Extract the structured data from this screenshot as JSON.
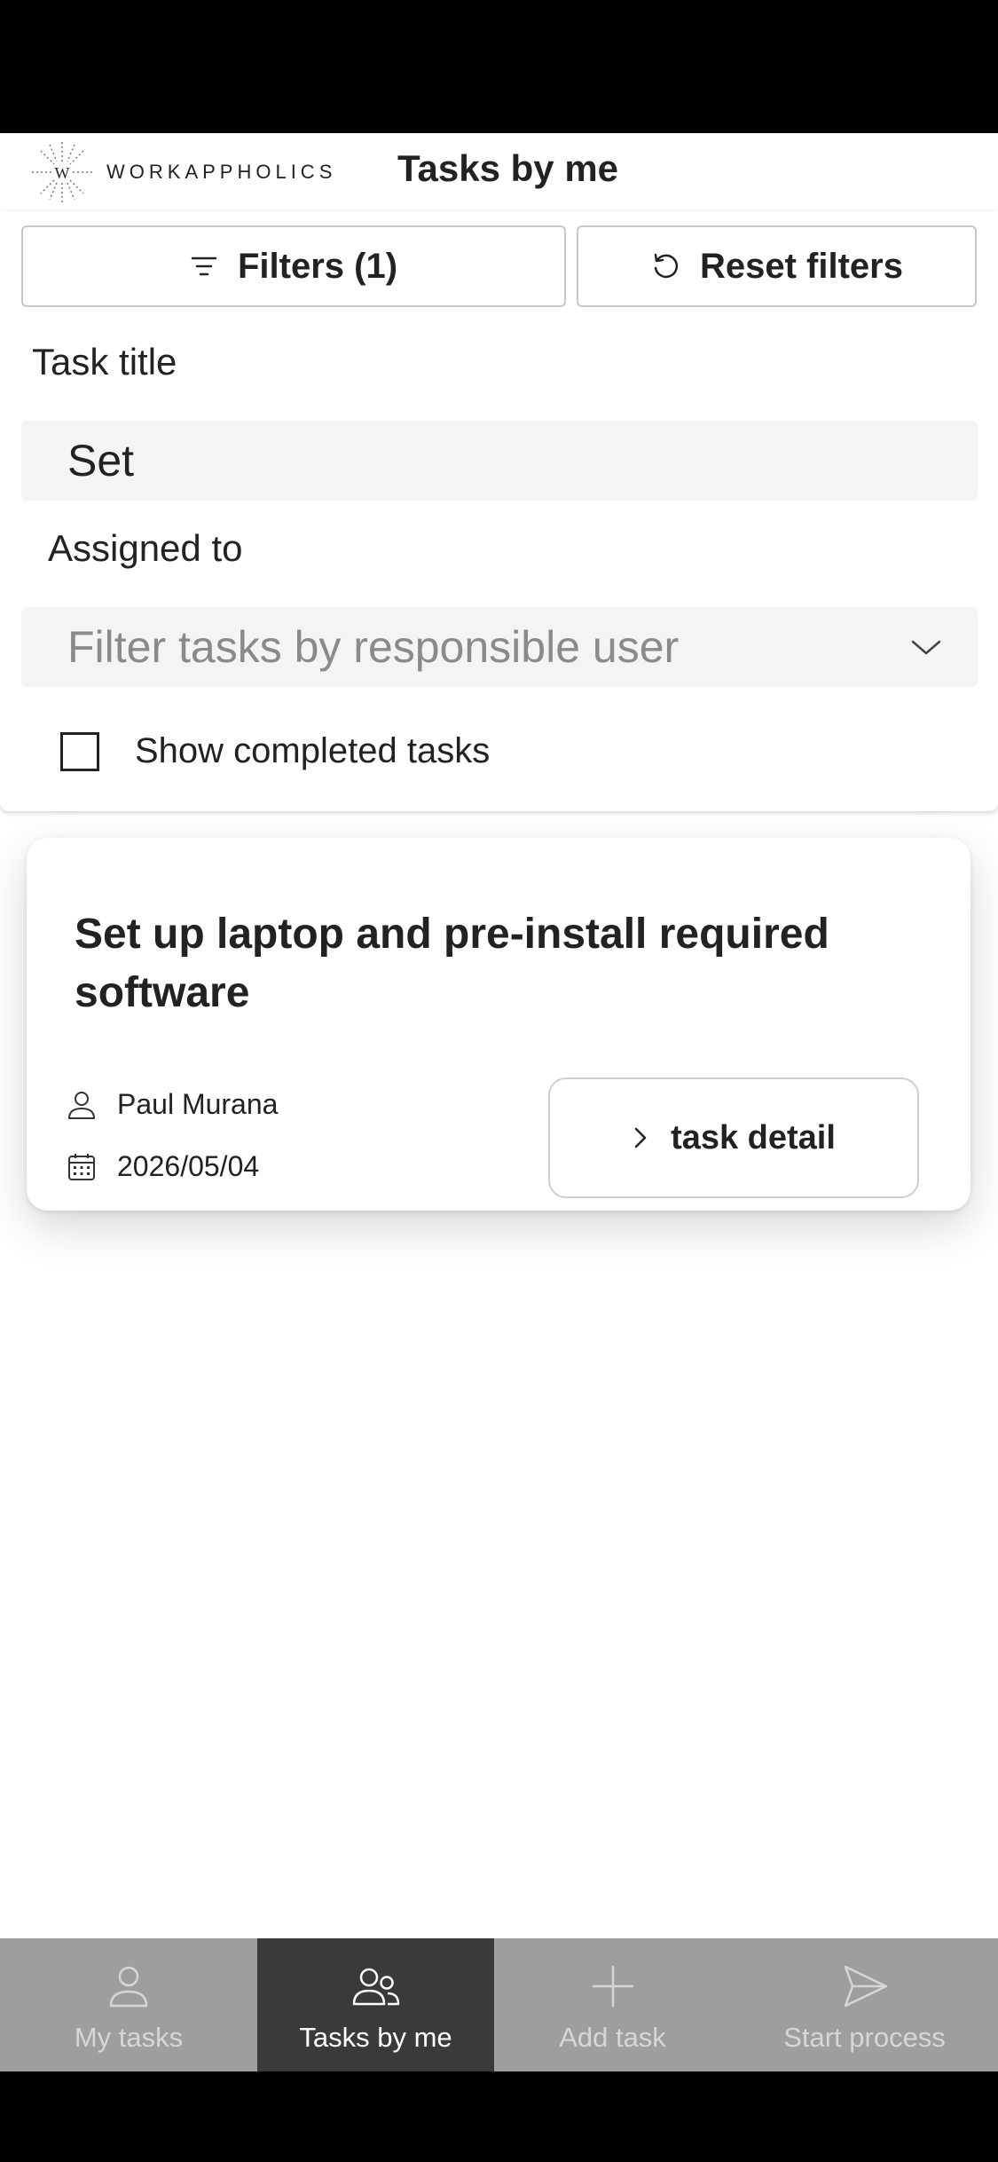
{
  "header": {
    "logo_text": "WORKAPPHOLICS",
    "logo_letter": "W",
    "title": "Tasks by me"
  },
  "filters": {
    "filters_button_label": "Filters (1)",
    "reset_button_label": "Reset filters",
    "task_title_label": "Task title",
    "task_title_value": "Set",
    "assigned_to_label": "Assigned to",
    "assigned_to_placeholder": "Filter tasks by responsible user",
    "show_completed_label": "Show completed tasks",
    "show_completed_checked": false
  },
  "task_card": {
    "title": "Set up laptop and pre-install required software",
    "assignee": "Paul Murana",
    "due_date": "2026/05/04",
    "detail_button_label": "task detail"
  },
  "tab_bar": {
    "tabs": [
      {
        "label": "My tasks",
        "icon": "user-icon",
        "active": false
      },
      {
        "label": "Tasks by me",
        "icon": "users-icon",
        "active": true
      },
      {
        "label": "Add task",
        "icon": "plus-icon",
        "active": false
      },
      {
        "label": "Start process",
        "icon": "send-icon",
        "active": false
      }
    ]
  },
  "colors": {
    "tab_bar_bg": "#9e9e9e",
    "tab_active_bg": "#3a3a3a",
    "field_bg": "#f4f4f4",
    "placeholder_text": "#8a8a8a"
  }
}
